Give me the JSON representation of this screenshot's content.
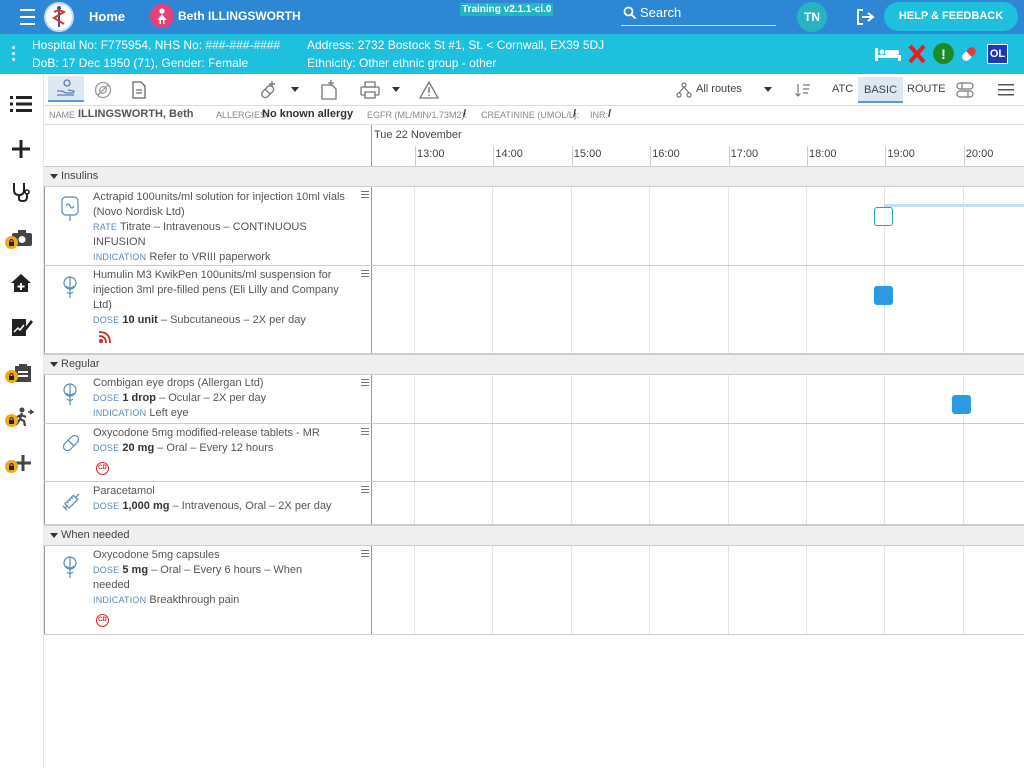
{
  "header": {
    "home_label": "Home",
    "patient_name": "Beth ILLINGSWORTH",
    "training_badge": "Training v2.1.1-ci.0",
    "search_label": "Search",
    "user_initials": "TN",
    "help_label": "HELP & FEEDBACK"
  },
  "patient_bar": {
    "line1_left": "Hospital No: F775954, NHS No: ###-###-####",
    "line1_right": "Address: 2732 Bostock St #1, St. < Cornwall, EX39 5DJ",
    "line2_left": "DoB: 17 Dec 1950 (71), Gender: Female",
    "line2_right": "Ethnicity: Other ethnic group - other",
    "ol_badge": "OL"
  },
  "toolbar": {
    "routes_label": "All routes",
    "atc_label": "ATC",
    "basic_label": "BASIC",
    "route_label": "ROUTE"
  },
  "infobar": {
    "name_label": "NAME",
    "name_value": "ILLINGSWORTH, Beth",
    "allergies_label": "ALLERGIES:",
    "allergies_value": "No known allergy",
    "egfr_label": "EGFR (ML/MIN/1.73M2):",
    "egfr_value": "/",
    "creat_label": "CREATININE (UMOL/L):",
    "creat_value": "/",
    "inr_label": "INR:",
    "inr_value": "/"
  },
  "timeline": {
    "date": "Tue 22 November",
    "hours": [
      "13:00",
      "14:00",
      "15:00",
      "16:00",
      "17:00",
      "18:00",
      "19:00",
      "20:00"
    ]
  },
  "sections": {
    "insulins": "Insulins",
    "regular": "Regular",
    "when_needed": "When needed"
  },
  "meds": [
    {
      "name": "Actrapid 100units/ml solution for injection 10ml vials (Novo Nordisk Ltd)",
      "label1": "RATE",
      "detail1_bold": "",
      "detail1": "Titrate – Intravenous – CONTINUOUS INFUSION",
      "label2": "INDICATION",
      "detail2": "Refer to VRIII paperwork",
      "icon": "infusion-bag-icon"
    },
    {
      "name": "Humulin M3 KwikPen 100units/ml suspension for injection 3ml pre-filled pens (Eli Lilly and Company Ltd)",
      "label1": "DOSE",
      "detail1_bold": "10 unit",
      "detail1": "– Subcutaneous – 2X per day",
      "icon": "rx-caduceus-icon",
      "badge": "feed-alert-icon"
    },
    {
      "name": "Combigan eye drops (Allergan Ltd)",
      "label1": "DOSE",
      "detail1_bold": "1 drop",
      "detail1": "– Ocular – 2X per day",
      "label2": "INDICATION",
      "detail2": "Left eye",
      "icon": "rx-caduceus-icon"
    },
    {
      "name": "Oxycodone 5mg modified-release tablets - MR",
      "label1": "DOSE",
      "detail1_bold": "20 mg",
      "detail1": "– Oral – Every 12 hours",
      "icon": "pill-icon",
      "badge": "CD"
    },
    {
      "name": "Paracetamol",
      "label1": "DOSE",
      "detail1_bold": "1,000 mg",
      "detail1": "– Intravenous, Oral – 2X per day",
      "icon": "syringe-icon"
    },
    {
      "name": "Oxycodone 5mg capsules",
      "label1": "DOSE",
      "detail1_bold": "5 mg",
      "detail1": "– Oral – Every 6 hours – When needed",
      "label2": "INDICATION",
      "detail2": "Breakthrough pain",
      "icon": "rx-caduceus-icon",
      "badge": "CD"
    }
  ],
  "colors": {
    "header_blue": "#2e87d5",
    "patient_bar_cyan": "#1ec0dd",
    "dose_blue": "#2a9be0",
    "lock_orange": "#f2a81d"
  }
}
